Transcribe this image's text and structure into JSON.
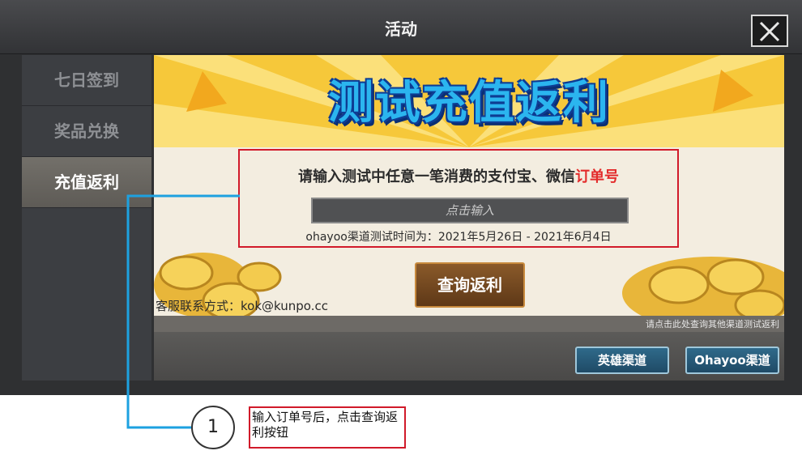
{
  "window": {
    "title": "活动",
    "close_icon": "close-icon"
  },
  "sidebar": {
    "items": [
      {
        "label": "七日签到",
        "active": false
      },
      {
        "label": "奖品兑换",
        "active": false
      },
      {
        "label": "充值返利",
        "active": true
      }
    ]
  },
  "banner": {
    "title": "测试充值返利",
    "color": "#2bb5ef"
  },
  "form": {
    "instruction_prefix": "请输入测试中任意一笔消费的支付宝、微信",
    "instruction_highlight": "订单号",
    "input_placeholder": "点击输入",
    "time_note": "ohayoo渠道测试时间为：2021年5月26日 - 2021年6月4日"
  },
  "actions": {
    "query_label": "查询返利"
  },
  "footer": {
    "contact": "客服联系方式：kok@kunpo.cc",
    "hint": "请点击此处查询其他渠道测试返利",
    "channel_hero": "英雄渠道",
    "channel_ohayoo": "Ohayoo渠道"
  },
  "annotation": {
    "number": "1",
    "text": "输入订单号后，点击查询返利按钮",
    "line_color": "#1da1e0",
    "box_color": "#d11a2a"
  }
}
